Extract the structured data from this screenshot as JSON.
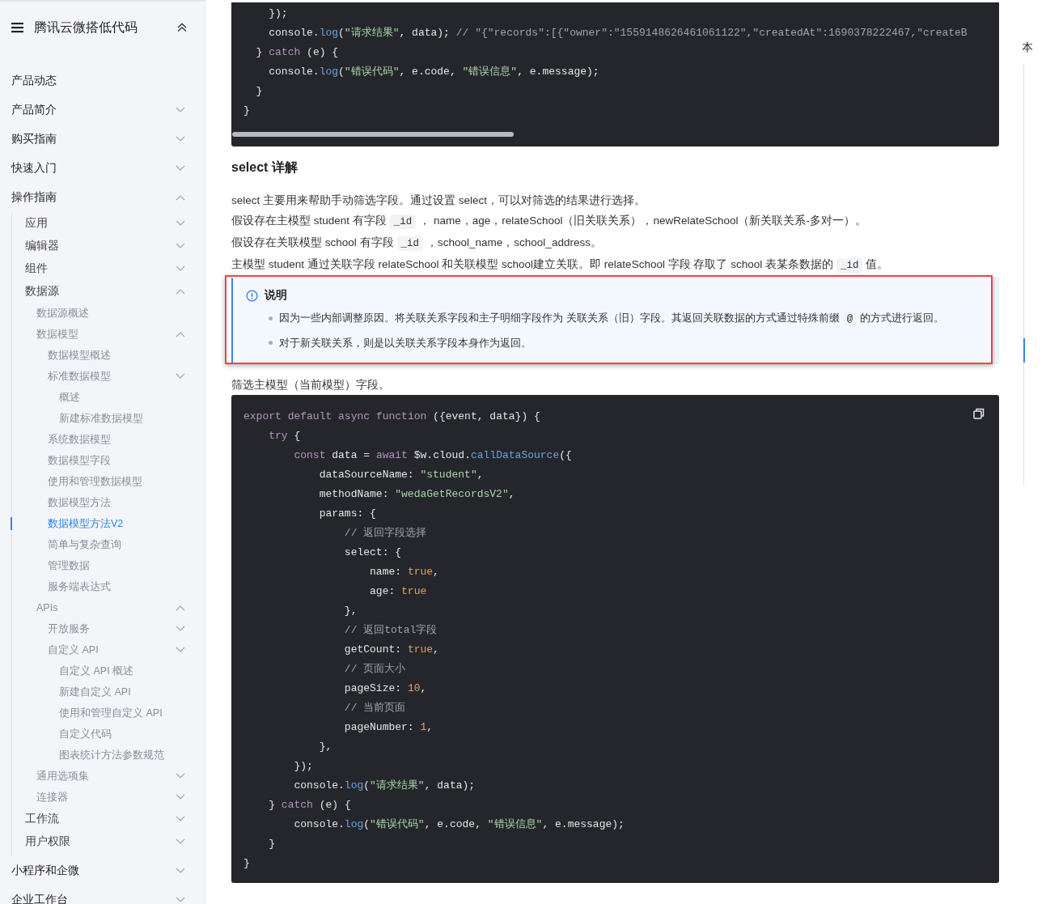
{
  "sidebar": {
    "title": "腾讯云微搭低代码",
    "items": [
      {
        "label": "产品动态",
        "selected": false
      },
      {
        "label": "产品简介",
        "selected": false,
        "expanded": false
      },
      {
        "label": "购买指南",
        "selected": false,
        "expanded": false
      },
      {
        "label": "快速入门",
        "selected": false,
        "expanded": false
      },
      {
        "label": "操作指南",
        "selected": false,
        "expanded": true,
        "children": [
          {
            "label": "应用",
            "selected": false,
            "expanded": false
          },
          {
            "label": "编辑器",
            "selected": false,
            "expanded": false
          },
          {
            "label": "组件",
            "selected": false,
            "expanded": false
          },
          {
            "label": "数据源",
            "selected": false,
            "expanded": true,
            "children": [
              {
                "label": "数据源概述",
                "selected": false
              },
              {
                "label": "数据模型",
                "selected": false,
                "expanded": true,
                "children": [
                  {
                    "label": "数据模型概述",
                    "selected": false
                  },
                  {
                    "label": "标准数据模型",
                    "selected": false,
                    "expanded": false,
                    "children": [
                      {
                        "label": "概述",
                        "selected": false
                      },
                      {
                        "label": "新建标准数据模型",
                        "selected": false
                      }
                    ]
                  },
                  {
                    "label": "系统数据模型",
                    "selected": false
                  },
                  {
                    "label": "数据模型字段",
                    "selected": false
                  },
                  {
                    "label": "使用和管理数据模型",
                    "selected": false
                  },
                  {
                    "label": "数据模型方法",
                    "selected": false
                  },
                  {
                    "label": "数据模型方法V2",
                    "selected": true
                  },
                  {
                    "label": "简单与复杂查询",
                    "selected": false
                  },
                  {
                    "label": "管理数据",
                    "selected": false
                  },
                  {
                    "label": "服务端表达式",
                    "selected": false
                  }
                ]
              },
              {
                "label": "APIs",
                "selected": false,
                "expanded": true,
                "children": [
                  {
                    "label": "开放服务",
                    "selected": false,
                    "expanded": false
                  },
                  {
                    "label": "自定义 API",
                    "selected": false,
                    "expanded": false,
                    "children": [
                      {
                        "label": "自定义 API 概述",
                        "selected": false
                      },
                      {
                        "label": "新建自定义 API",
                        "selected": false
                      },
                      {
                        "label": "使用和管理自定义 API",
                        "selected": false
                      },
                      {
                        "label": "自定义代码",
                        "selected": false
                      },
                      {
                        "label": "图表统计方法参数规范",
                        "selected": false
                      }
                    ]
                  }
                ]
              },
              {
                "label": "通用选项集",
                "selected": false,
                "expanded": false
              },
              {
                "label": "连接器",
                "selected": false,
                "expanded": false
              }
            ]
          },
          {
            "label": "工作流",
            "selected": false,
            "expanded": false
          },
          {
            "label": "用户权限",
            "selected": false,
            "expanded": false
          }
        ]
      },
      {
        "label": "小程序和企微",
        "selected": false,
        "expanded": false
      },
      {
        "label": "企业工作台",
        "selected": false,
        "expanded": false
      }
    ]
  },
  "blocks": [
    {
      "kind": "code",
      "scrollbar": true,
      "lines": [
        "    });",
        "    console.log(\"请求结果\", data); // \"{\"records\":[{\"owner\":\"1559148626461061122\",\"createdAt\":1690378222467,\"createB",
        "  } catch (e) {",
        "    console.log(\"错误代码\", e.code, \"错误信息\", e.message);",
        "  }",
        "}"
      ]
    },
    {
      "kind": "heading",
      "text": "select 详解"
    },
    {
      "kind": "paragraph",
      "segments": [
        {
          "kind": "text",
          "text": "select 主要用来帮助手动筛选字段。通过设置 select，可以对筛选的结果进行选择。"
        }
      ]
    },
    {
      "kind": "paragraph",
      "segments": [
        {
          "kind": "text",
          "text": "假设存在主模型 student 有字段"
        },
        {
          "kind": "code",
          "text": "_id"
        },
        {
          "kind": "text",
          "text": "， name，age，relateSchool（旧关联关系），newRelateSchool（新关联关系-多对一）。"
        }
      ]
    },
    {
      "kind": "paragraph",
      "segments": [
        {
          "kind": "text",
          "text": "假设存在关联模型 school 有字段"
        },
        {
          "kind": "code",
          "text": "_id"
        },
        {
          "kind": "text",
          "text": "，school_name，school_address。"
        }
      ]
    },
    {
      "kind": "paragraph",
      "segments": [
        {
          "kind": "text",
          "text": "主模型 student 通过关联字段 relateSchool 和关联模型 school建立关联。即 relateSchool 字段 存取了 school 表某条数据的"
        },
        {
          "kind": "code",
          "text": "_id"
        },
        {
          "kind": "text",
          "text": "值。"
        }
      ]
    },
    {
      "kind": "note",
      "title": "说明",
      "bullets": [
        [
          {
            "kind": "text",
            "text": "因为一些内部调整原因。将关联关系字段和主子明细字段作为 关联关系（旧）字段。其返回关联数据的方式通过特殊前缀"
          },
          {
            "kind": "code",
            "text": "@"
          },
          {
            "kind": "text",
            "text": "的方式进行返回。"
          }
        ],
        [
          {
            "kind": "text",
            "text": "对于新关联关系，则是以关联关系字段本身作为返回。"
          }
        ]
      ]
    },
    {
      "kind": "paragraph",
      "segments": [
        {
          "kind": "text",
          "text": "筛选主模型（当前模型）字段。"
        }
      ]
    },
    {
      "kind": "code",
      "copy": true,
      "lines": [
        "export default async function ({event, data}) {",
        "    try {",
        "        const data = await $w.cloud.callDataSource({",
        "            dataSourceName: \"student\",",
        "            methodName: \"wedaGetRecordsV2\",",
        "            params: {",
        "                // 返回字段选择",
        "                select: {",
        "                    name: true,",
        "                    age: true",
        "                },",
        "                // 返回total字段",
        "                getCount: true,",
        "                // 页面大小",
        "                pageSize: 10,",
        "                // 当前页面",
        "                pageNumber: 1,",
        "            },",
        "        });",
        "        console.log(\"请求结果\", data);",
        "    } catch (e) {",
        "        console.log(\"错误代码\", e.code, \"错误信息\", e.message);",
        "    }",
        "}"
      ]
    }
  ],
  "toc": {
    "title": "本"
  }
}
